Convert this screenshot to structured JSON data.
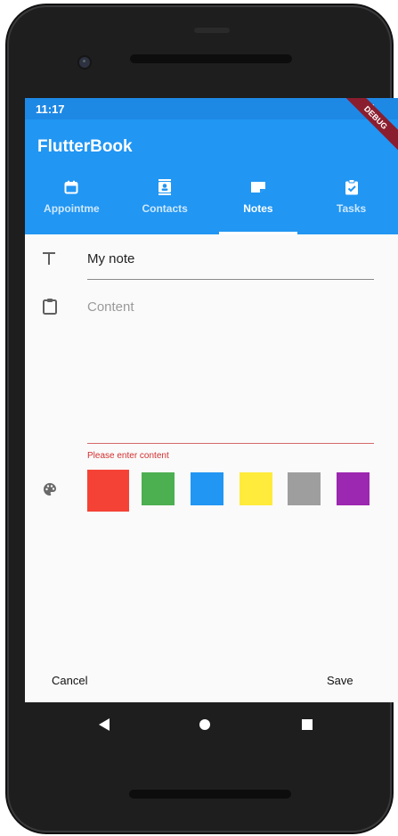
{
  "status_bar": {
    "time": "11:17",
    "debug_banner": "DEBUG"
  },
  "app_bar": {
    "title": "FlutterBook"
  },
  "tabs": [
    {
      "label": "Appointme",
      "icon": "calendar-icon",
      "active": false
    },
    {
      "label": "Contacts",
      "icon": "contacts-icon",
      "active": false
    },
    {
      "label": "Notes",
      "icon": "note-icon",
      "active": true
    },
    {
      "label": "Tasks",
      "icon": "assignment-check-icon",
      "active": false
    }
  ],
  "form": {
    "title_value": "My note",
    "content_placeholder": "Content",
    "content_error": "Please enter content"
  },
  "colors": {
    "app_bar": "#2196f3",
    "swatches": [
      {
        "name": "red",
        "hex": "#f44336",
        "selected": true
      },
      {
        "name": "green",
        "hex": "#4caf50",
        "selected": false
      },
      {
        "name": "blue",
        "hex": "#2196f3",
        "selected": false
      },
      {
        "name": "yellow",
        "hex": "#ffeb3b",
        "selected": false
      },
      {
        "name": "grey",
        "hex": "#9e9e9e",
        "selected": false
      },
      {
        "name": "purple",
        "hex": "#9c27b0",
        "selected": false
      }
    ]
  },
  "actions": {
    "cancel_label": "Cancel",
    "save_label": "Save"
  }
}
